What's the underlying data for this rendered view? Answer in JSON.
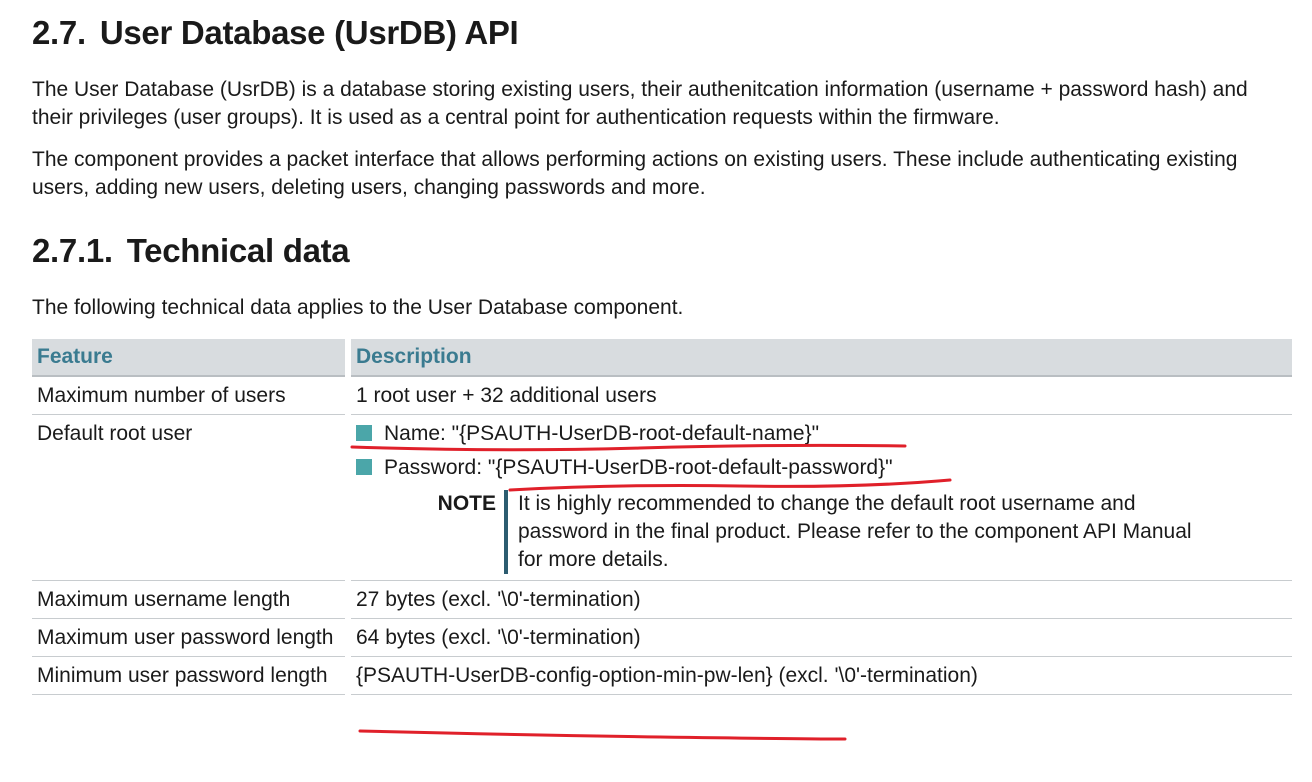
{
  "section": {
    "number": "2.7.",
    "title": "User Database (UsrDB) API",
    "paragraphs": [
      "The User Database (UsrDB) is a database storing existing users, their authenitcation information (username + password hash) and their privileges (user groups). It is used as a central point for authentication requests within the firmware.",
      "The component provides a packet interface that allows performing actions on existing users. These include authenticating existing users, adding new users, deleting users, changing passwords and more."
    ]
  },
  "subsection": {
    "number": "2.7.1.",
    "title": "Technical data",
    "intro": "The following technical data applies to the User Database component."
  },
  "table": {
    "headers": [
      "Feature",
      "Description"
    ],
    "rows": [
      {
        "feature": "Maximum number of users",
        "description": "1 root user + 32 additional users"
      },
      {
        "feature": "Default root user",
        "bullets": [
          "Name: \"{PSAUTH-UserDB-root-default-name}\"",
          "Password: \"{PSAUTH-UserDB-root-default-password}\""
        ],
        "note_label": "NOTE",
        "note_text": "It is highly recommended to change the default root username and password in the final product. Please refer to the component API Manual for more details."
      },
      {
        "feature": "Maximum username length",
        "description": "27 bytes (excl. '\\0'-termination)"
      },
      {
        "feature": "Maximum user password length",
        "description": "64 bytes (excl. '\\0'-termination)"
      },
      {
        "feature": "Minimum user password length",
        "description": "{PSAUTH-UserDB-config-option-min-pw-len} (excl. '\\0'-termination)"
      }
    ]
  },
  "colors": {
    "header_text": "#3a7b90",
    "header_bg": "#d8dcdf",
    "bullet": "#4ba6a9",
    "annotation_underline": "#e0202a"
  }
}
